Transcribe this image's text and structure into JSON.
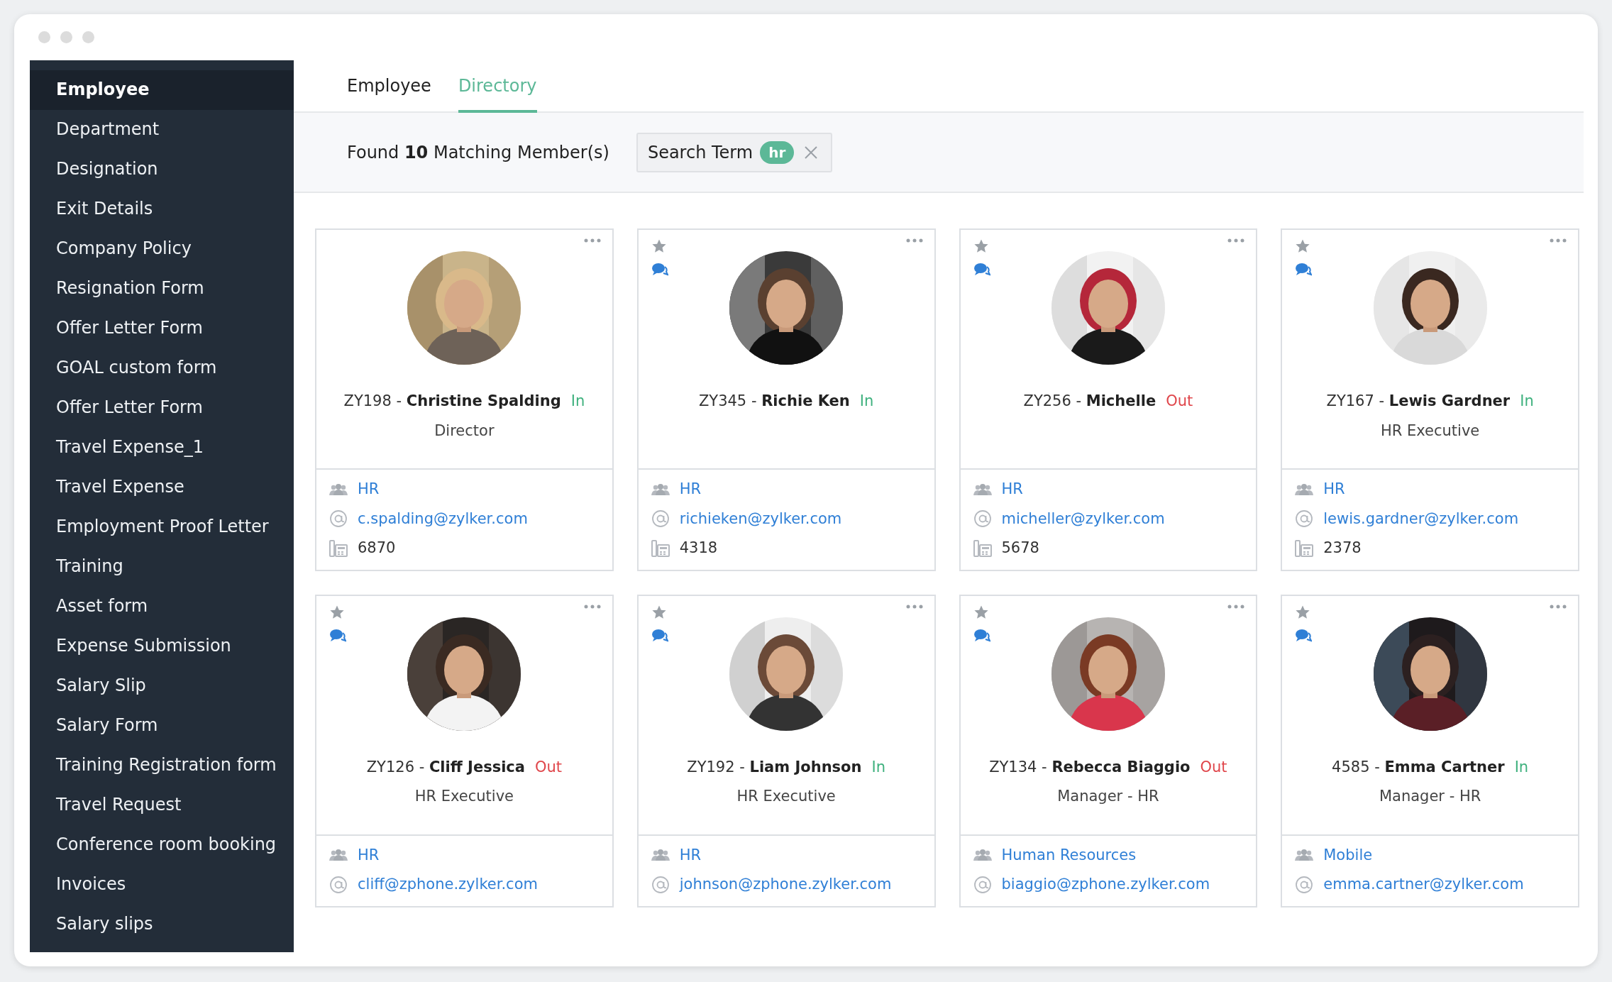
{
  "sidebar": {
    "items": [
      {
        "label": "Employee",
        "selected": true
      },
      {
        "label": "Department",
        "selected": false
      },
      {
        "label": "Designation",
        "selected": false
      },
      {
        "label": "Exit Details",
        "selected": false
      },
      {
        "label": "Company Policy",
        "selected": false
      },
      {
        "label": "Resignation Form",
        "selected": false
      },
      {
        "label": "Offer Letter Form",
        "selected": false
      },
      {
        "label": "GOAL custom form",
        "selected": false
      },
      {
        "label": "Offer Letter Form",
        "selected": false
      },
      {
        "label": "Travel Expense_1",
        "selected": false
      },
      {
        "label": "Travel Expense",
        "selected": false
      },
      {
        "label": "Employment Proof Letter",
        "selected": false
      },
      {
        "label": "Training",
        "selected": false
      },
      {
        "label": "Asset form",
        "selected": false
      },
      {
        "label": "Expense Submission",
        "selected": false
      },
      {
        "label": "Salary Slip",
        "selected": false
      },
      {
        "label": "Salary Form",
        "selected": false
      },
      {
        "label": "Training Registration form",
        "selected": false
      },
      {
        "label": "Travel Request",
        "selected": false
      },
      {
        "label": "Conference room booking",
        "selected": false
      },
      {
        "label": "Invoices",
        "selected": false
      },
      {
        "label": "Salary slips",
        "selected": false
      }
    ]
  },
  "tabs": [
    {
      "label": "Employee",
      "selected": false
    },
    {
      "label": "Directory",
      "selected": true
    }
  ],
  "results": {
    "summary": "Found **10** Matching Member(s)",
    "search_chip": {
      "label": "Search Term",
      "term": "hr"
    }
  },
  "cards": [
    {
      "quick_icons": false,
      "id": "ZY198 -",
      "name": "Christine Spalding",
      "status": "In",
      "present": true,
      "designation": "Director",
      "department": "HR",
      "email": "c.spalding@zylker.com",
      "extension": "6870"
    },
    {
      "quick_icons": true,
      "id": "ZY345 -",
      "name": "Richie Ken",
      "status": "In",
      "present": true,
      "department": "HR",
      "email": "richieken@zylker.com",
      "extension": "4318"
    },
    {
      "quick_icons": true,
      "id": "ZY256 -",
      "name": "Michelle",
      "status": "Out",
      "present": false,
      "department": "HR",
      "email": "micheller@zylker.com",
      "extension": "5678"
    },
    {
      "quick_icons": true,
      "id": "ZY167 -",
      "name": "Lewis Gardner",
      "status": "In",
      "present": true,
      "designation": "HR Executive",
      "department": "HR",
      "email": "lewis.gardner@zylker.com",
      "extension": "2378"
    },
    {
      "quick_icons": true,
      "id": "ZY126 -",
      "name": "Cliff Jessica",
      "status": "Out",
      "present": false,
      "designation": "HR Executive",
      "department": "HR",
      "email": "cliff@zphone.zylker.com"
    },
    {
      "quick_icons": true,
      "id": "ZY192 -",
      "name": "Liam Johnson",
      "status": "In",
      "present": true,
      "designation": "HR Executive",
      "department": "HR",
      "email": "johnson@zphone.zylker.com"
    },
    {
      "quick_icons": true,
      "id": "ZY134 -",
      "name": "Rebecca Biaggio",
      "status": "Out",
      "present": false,
      "designation": "Manager - HR",
      "department": "Human Resources",
      "email": "biaggio@zphone.zylker.com"
    },
    {
      "quick_icons": true,
      "id": "4585 -",
      "name": "Emma Cartner",
      "status": "In",
      "present": true,
      "designation": "Manager - HR",
      "department": "Mobile",
      "email": "emma.cartner@zylker.com"
    }
  ]
}
